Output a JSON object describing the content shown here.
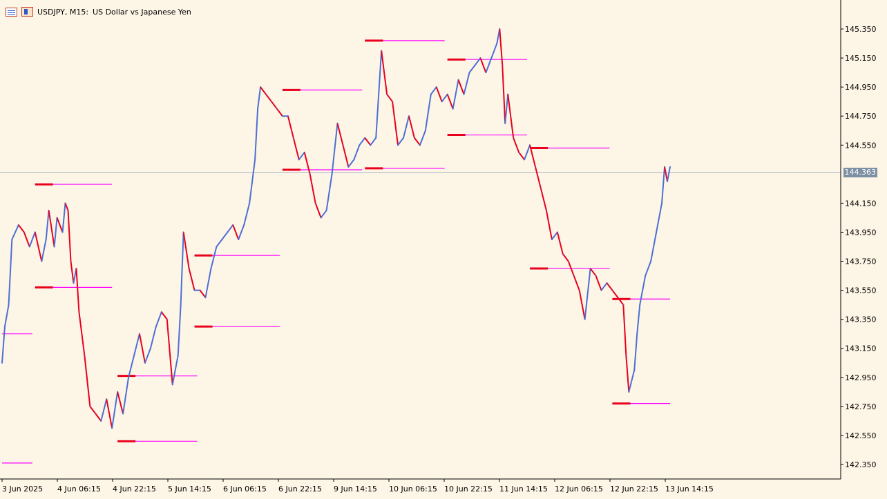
{
  "header": {
    "symbol_label": "USDJPY, M15:",
    "description": "US Dollar vs Japanese Yen",
    "icons": [
      "chart-list-icon",
      "chart-window-icon"
    ]
  },
  "current_price": "144.363",
  "colors": {
    "background": "#fdf5e6",
    "bull": "#4c6fd6",
    "bear": "#e8001c",
    "level_line": "#ff00ff",
    "level_marker": "#e8001c",
    "current_line": "#aab4c3",
    "axis": "#000000"
  },
  "chart_data": {
    "type": "line",
    "ylim": [
      142.25,
      145.45
    ],
    "y_ticks": [
      "145.350",
      "145.150",
      "144.950",
      "144.750",
      "144.550",
      "144.150",
      "143.950",
      "143.750",
      "143.550",
      "143.350",
      "143.150",
      "142.950",
      "142.750",
      "142.550",
      "142.350"
    ],
    "x_ticks": [
      "3 Jun 2025",
      "4 Jun 06:15",
      "4 Jun 22:15",
      "5 Jun 14:15",
      "6 Jun 06:15",
      "6 Jun 22:15",
      "9 Jun 14:15",
      "10 Jun 06:15",
      "10 Jun 22:15",
      "11 Jun 14:15",
      "12 Jun 06:15",
      "12 Jun 22:15",
      "13 Jun 14:15"
    ],
    "x_range": [
      0,
      12.15
    ],
    "series": [
      {
        "points": [
          [
            0.0,
            143.05
          ],
          [
            0.05,
            143.3
          ],
          [
            0.12,
            143.45
          ],
          [
            0.18,
            143.9
          ],
          [
            0.3,
            144.0
          ],
          [
            0.4,
            143.95
          ],
          [
            0.5,
            143.85
          ],
          [
            0.6,
            143.95
          ],
          [
            0.72,
            143.75
          ],
          [
            0.8,
            143.9
          ],
          [
            0.85,
            144.1
          ],
          [
            0.95,
            143.85
          ],
          [
            1.0,
            144.05
          ],
          [
            1.1,
            143.95
          ],
          [
            1.15,
            144.15
          ],
          [
            1.2,
            144.1
          ],
          [
            1.25,
            143.75
          ],
          [
            1.3,
            143.6
          ],
          [
            1.35,
            143.7
          ],
          [
            1.4,
            143.4
          ],
          [
            1.5,
            143.1
          ],
          [
            1.6,
            142.75
          ],
          [
            1.7,
            142.7
          ],
          [
            1.8,
            142.65
          ],
          [
            1.9,
            142.8
          ],
          [
            2.0,
            142.6
          ],
          [
            2.1,
            142.85
          ],
          [
            2.2,
            142.7
          ],
          [
            2.3,
            142.95
          ],
          [
            2.4,
            143.1
          ],
          [
            2.5,
            143.25
          ],
          [
            2.6,
            143.05
          ],
          [
            2.7,
            143.15
          ],
          [
            2.8,
            143.3
          ],
          [
            2.9,
            143.4
          ],
          [
            3.0,
            143.35
          ],
          [
            3.1,
            142.9
          ],
          [
            3.2,
            143.1
          ],
          [
            3.25,
            143.45
          ],
          [
            3.3,
            143.95
          ],
          [
            3.4,
            143.7
          ],
          [
            3.5,
            143.55
          ],
          [
            3.6,
            143.55
          ],
          [
            3.7,
            143.5
          ],
          [
            3.8,
            143.7
          ],
          [
            3.9,
            143.85
          ],
          [
            4.0,
            143.9
          ],
          [
            4.1,
            143.95
          ],
          [
            4.2,
            144.0
          ],
          [
            4.3,
            143.9
          ],
          [
            4.4,
            144.0
          ],
          [
            4.5,
            144.15
          ],
          [
            4.6,
            144.45
          ],
          [
            4.65,
            144.8
          ],
          [
            4.7,
            144.95
          ],
          [
            4.8,
            144.9
          ],
          [
            4.9,
            144.85
          ],
          [
            5.0,
            144.8
          ],
          [
            5.1,
            144.75
          ],
          [
            5.2,
            144.75
          ],
          [
            5.3,
            144.6
          ],
          [
            5.4,
            144.45
          ],
          [
            5.5,
            144.5
          ],
          [
            5.6,
            144.35
          ],
          [
            5.7,
            144.15
          ],
          [
            5.8,
            144.05
          ],
          [
            5.9,
            144.1
          ],
          [
            6.0,
            144.35
          ],
          [
            6.1,
            144.7
          ],
          [
            6.2,
            144.55
          ],
          [
            6.3,
            144.4
          ],
          [
            6.4,
            144.45
          ],
          [
            6.5,
            144.55
          ],
          [
            6.6,
            144.6
          ],
          [
            6.7,
            144.55
          ],
          [
            6.8,
            144.6
          ],
          [
            6.85,
            144.9
          ],
          [
            6.9,
            145.2
          ],
          [
            7.0,
            144.9
          ],
          [
            7.1,
            144.85
          ],
          [
            7.2,
            144.55
          ],
          [
            7.3,
            144.6
          ],
          [
            7.4,
            144.75
          ],
          [
            7.5,
            144.6
          ],
          [
            7.6,
            144.55
          ],
          [
            7.7,
            144.65
          ],
          [
            7.8,
            144.9
          ],
          [
            7.9,
            144.95
          ],
          [
            8.0,
            144.85
          ],
          [
            8.1,
            144.9
          ],
          [
            8.2,
            144.8
          ],
          [
            8.3,
            145.0
          ],
          [
            8.4,
            144.9
          ],
          [
            8.5,
            145.05
          ],
          [
            8.6,
            145.1
          ],
          [
            8.7,
            145.15
          ],
          [
            8.8,
            145.05
          ],
          [
            8.9,
            145.15
          ],
          [
            9.0,
            145.25
          ],
          [
            9.05,
            145.35
          ],
          [
            9.1,
            145.1
          ],
          [
            9.15,
            144.7
          ],
          [
            9.2,
            144.9
          ],
          [
            9.25,
            144.75
          ],
          [
            9.3,
            144.6
          ],
          [
            9.4,
            144.5
          ],
          [
            9.5,
            144.45
          ],
          [
            9.6,
            144.55
          ],
          [
            9.7,
            144.4
          ],
          [
            9.8,
            144.25
          ],
          [
            9.9,
            144.1
          ],
          [
            10.0,
            143.9
          ],
          [
            10.1,
            143.95
          ],
          [
            10.2,
            143.8
          ],
          [
            10.3,
            143.75
          ],
          [
            10.4,
            143.65
          ],
          [
            10.5,
            143.55
          ],
          [
            10.6,
            143.35
          ],
          [
            10.7,
            143.7
          ],
          [
            10.8,
            143.65
          ],
          [
            10.9,
            143.55
          ],
          [
            11.0,
            143.6
          ],
          [
            11.1,
            143.55
          ],
          [
            11.2,
            143.5
          ],
          [
            11.3,
            143.45
          ],
          [
            11.35,
            143.1
          ],
          [
            11.4,
            142.85
          ],
          [
            11.5,
            143.0
          ],
          [
            11.55,
            143.25
          ],
          [
            11.6,
            143.45
          ],
          [
            11.7,
            143.65
          ],
          [
            11.8,
            143.75
          ],
          [
            11.9,
            143.95
          ],
          [
            12.0,
            144.15
          ],
          [
            12.05,
            144.4
          ],
          [
            12.1,
            144.3
          ],
          [
            12.15,
            144.4
          ]
        ]
      }
    ],
    "levels": [
      {
        "x1": 0.0,
        "x2": 0.55,
        "y": 143.25
      },
      {
        "x1": 0.0,
        "x2": 0.55,
        "y": 142.36
      },
      {
        "x1": 0.6,
        "x2": 2.0,
        "y": 144.28,
        "marker": true
      },
      {
        "x1": 0.6,
        "x2": 2.0,
        "y": 143.57,
        "marker": true
      },
      {
        "x1": 2.1,
        "x2": 3.55,
        "y": 142.96,
        "marker": true
      },
      {
        "x1": 2.1,
        "x2": 3.55,
        "y": 142.51,
        "marker": true
      },
      {
        "x1": 3.5,
        "x2": 5.05,
        "y": 143.79,
        "marker": true
      },
      {
        "x1": 3.5,
        "x2": 5.05,
        "y": 143.3,
        "marker": true
      },
      {
        "x1": 5.1,
        "x2": 6.55,
        "y": 144.93,
        "marker": true
      },
      {
        "x1": 5.1,
        "x2": 6.55,
        "y": 144.38,
        "marker": true
      },
      {
        "x1": 6.6,
        "x2": 8.05,
        "y": 145.27,
        "marker": true
      },
      {
        "x1": 6.6,
        "x2": 8.05,
        "y": 144.39,
        "marker": true
      },
      {
        "x1": 8.1,
        "x2": 9.55,
        "y": 145.14,
        "marker": true
      },
      {
        "x1": 8.1,
        "x2": 9.55,
        "y": 144.62,
        "marker": true
      },
      {
        "x1": 9.6,
        "x2": 11.05,
        "y": 144.53,
        "marker": true
      },
      {
        "x1": 9.6,
        "x2": 11.05,
        "y": 143.7,
        "marker": true
      },
      {
        "x1": 11.1,
        "x2": 12.15,
        "y": 143.49,
        "marker": true
      },
      {
        "x1": 11.1,
        "x2": 12.15,
        "y": 142.77,
        "marker": true
      }
    ],
    "current_value": 144.363,
    "grid": false
  }
}
